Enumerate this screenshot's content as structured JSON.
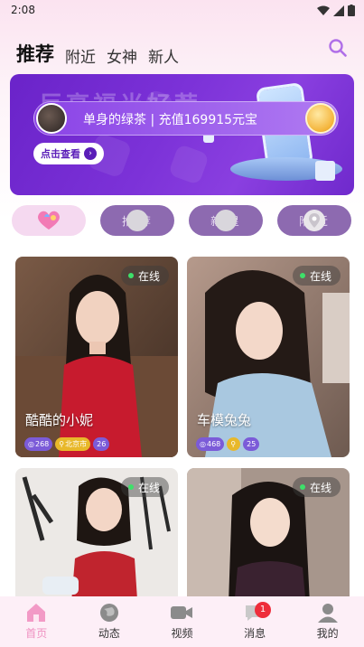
{
  "status_bar": {
    "time": "2:08"
  },
  "tabs": [
    {
      "label": "推荐",
      "active": true
    },
    {
      "label": "附近",
      "active": false
    },
    {
      "label": "女神",
      "active": false
    },
    {
      "label": "新人",
      "active": false
    }
  ],
  "banner": {
    "title": "巨亨福当好荐",
    "ticker_text": "单身的绿茶  |  充值169915元宝",
    "view_label": "点击查看",
    "view_arrow": "›"
  },
  "categories": [
    {
      "label": ""
    },
    {
      "label": "推  荐"
    },
    {
      "label": "新  星"
    },
    {
      "label": "附  近"
    }
  ],
  "cards": [
    {
      "name": "酷酷的小妮",
      "online_label": "在线",
      "tags": [
        "268",
        "北京市",
        "26"
      ]
    },
    {
      "name": "车模兔兔",
      "online_label": "在线",
      "tags": [
        "468",
        "",
        "25"
      ]
    },
    {
      "name": "",
      "online_label": "在线",
      "tags": []
    },
    {
      "name": "",
      "online_label": "在线",
      "tags": []
    }
  ],
  "bottom_nav": [
    {
      "label": "首页",
      "icon": "home-icon",
      "active": true
    },
    {
      "label": "动态",
      "icon": "globe-icon",
      "active": false
    },
    {
      "label": "视频",
      "icon": "video-icon",
      "active": false
    },
    {
      "label": "消息",
      "icon": "message-icon",
      "active": false,
      "badge": "1"
    },
    {
      "label": "我的",
      "icon": "profile-icon",
      "active": false
    }
  ],
  "colors": {
    "accent_pink": "#ef8fc0",
    "banner_purple": "#6a23c9",
    "online_green": "#3ee06a",
    "badge_red": "#ee2d3b"
  }
}
